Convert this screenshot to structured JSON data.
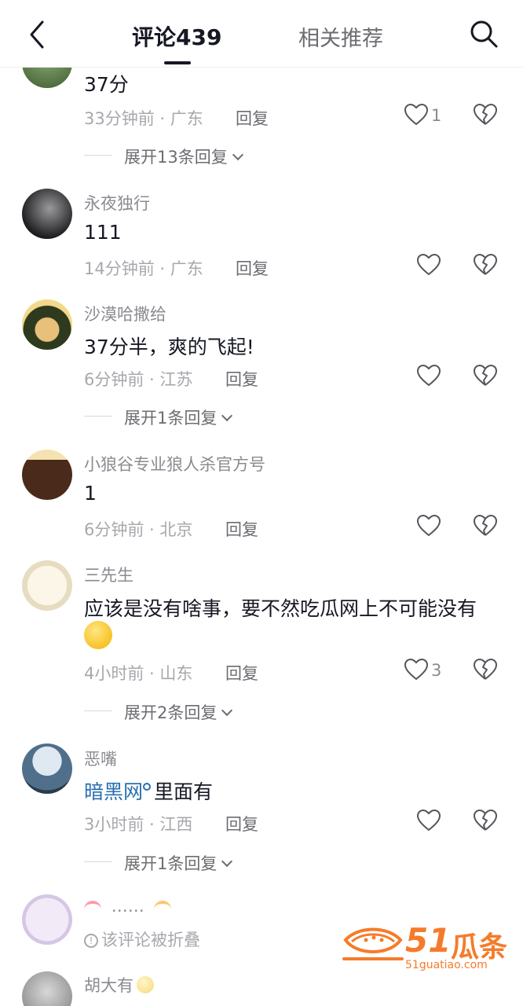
{
  "header": {
    "tab_comments": "评论439",
    "tab_related": "相关推荐"
  },
  "comments": [
    {
      "text": "37分",
      "time": "33分钟前 · 广东",
      "reply": "回复",
      "likes": "1",
      "expand": "展开13条回复"
    },
    {
      "name": "永夜独行",
      "text": "111",
      "time": "14分钟前 · 广东",
      "reply": "回复"
    },
    {
      "name": "沙漠哈撒给",
      "text": "37分半，爽的飞起!",
      "time": "6分钟前 · 江苏",
      "reply": "回复",
      "expand": "展开1条回复"
    },
    {
      "name": "小狼谷专业狼人杀官方号",
      "text": "1",
      "time": "6分钟前 · 北京",
      "reply": "回复"
    },
    {
      "name": "三先生",
      "text": "应该是没有啥事，要不然吃瓜网上不可能没有",
      "time": "4小时前 · 山东",
      "reply": "回复",
      "likes": "3",
      "expand": "展开2条回复"
    },
    {
      "name": "恶嘴",
      "link_text": "暗黑网",
      "text_after": "里面有",
      "time": "3小时前 · 江西",
      "reply": "回复",
      "expand": "展开1条回复"
    },
    {
      "name_text": "……",
      "folded": "该评论被折叠"
    },
    {
      "name": "胡大有"
    }
  ],
  "watermark": {
    "number": "51",
    "brand": "瓜条",
    "url": "51guatiao.com"
  },
  "colors": {
    "primary_text": "#161823",
    "secondary_text": "#8a8b91",
    "link": "#2a6fb0",
    "watermark": "#f57b2a"
  }
}
